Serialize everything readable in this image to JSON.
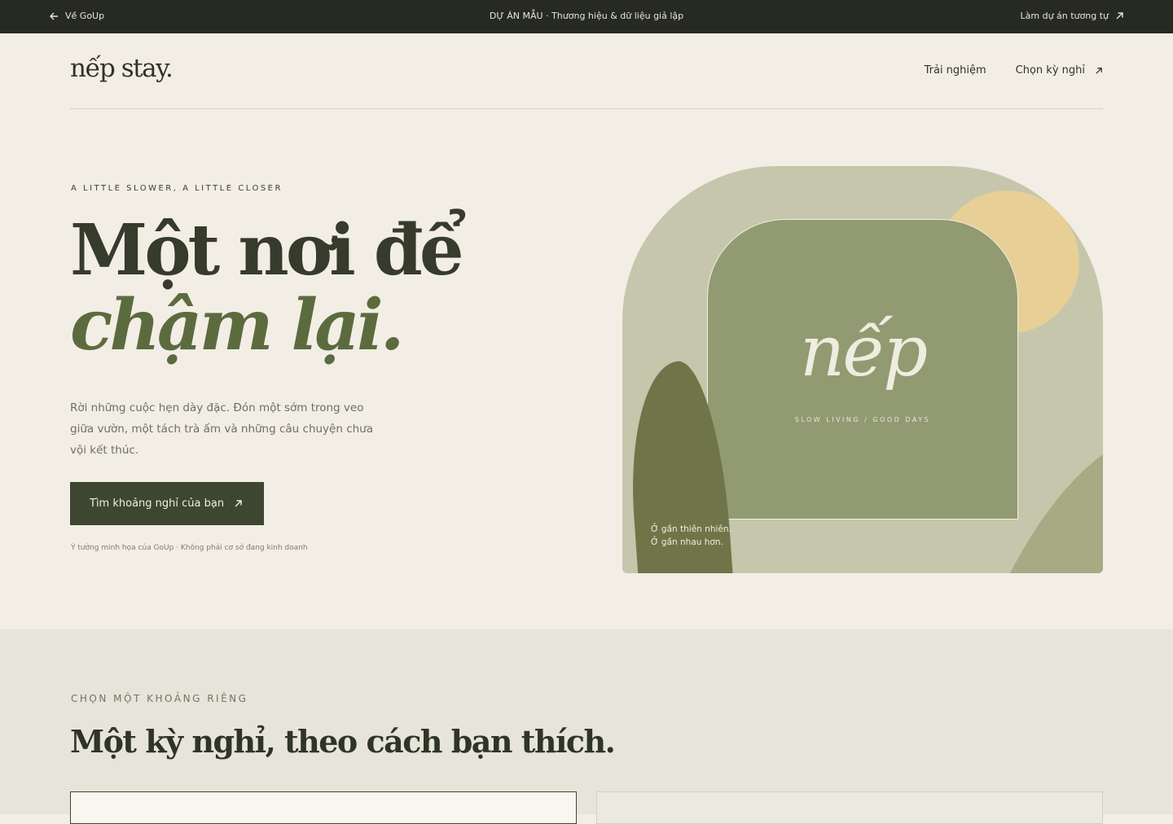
{
  "topbar": {
    "back_label": "Về GoUp",
    "center_label": "DỰ ÁN MẪU · Thương hiệu & dữ liệu giả lập",
    "right_label": "Làm dự án tương tự"
  },
  "header": {
    "logo": "nếp stay.",
    "nav": [
      {
        "label": "Trải nghiệm"
      },
      {
        "label": "Chọn kỳ nghỉ"
      }
    ]
  },
  "hero": {
    "eyebrow": "A LITTLE SLOWER, A LITTLE CLOSER",
    "title_line1": "Một nơi để",
    "title_line2": "chậm lại.",
    "lede": "Rời những cuộc hẹn dày đặc. Đón một sớm trong veo giữa vườn, một tách trà ấm và những câu chuyện chưa vội kết thúc.",
    "cta_label": "Tìm khoảng nghỉ của bạn",
    "note": "Ý tưởng minh họa của GoUp · Không phải cơ sở đang kinh doanh"
  },
  "art": {
    "mark": "nếp",
    "mark_sub": "SLOW LIVING / GOOD DAYS",
    "caption_line1": "Ở gần thiên nhiên.",
    "caption_line2": "Ở gần nhau hơn."
  },
  "section2": {
    "eyebrow": "CHỌN MỘT KHOẢNG RIÊNG",
    "title": "Một kỳ nghỉ, theo cách bạn thích."
  },
  "colors": {
    "topbar": "#262a22",
    "background": "#f2eee6",
    "accent": "#3d4630",
    "accent_italic": "#5c6b3e",
    "sun": "#e7cf96"
  }
}
